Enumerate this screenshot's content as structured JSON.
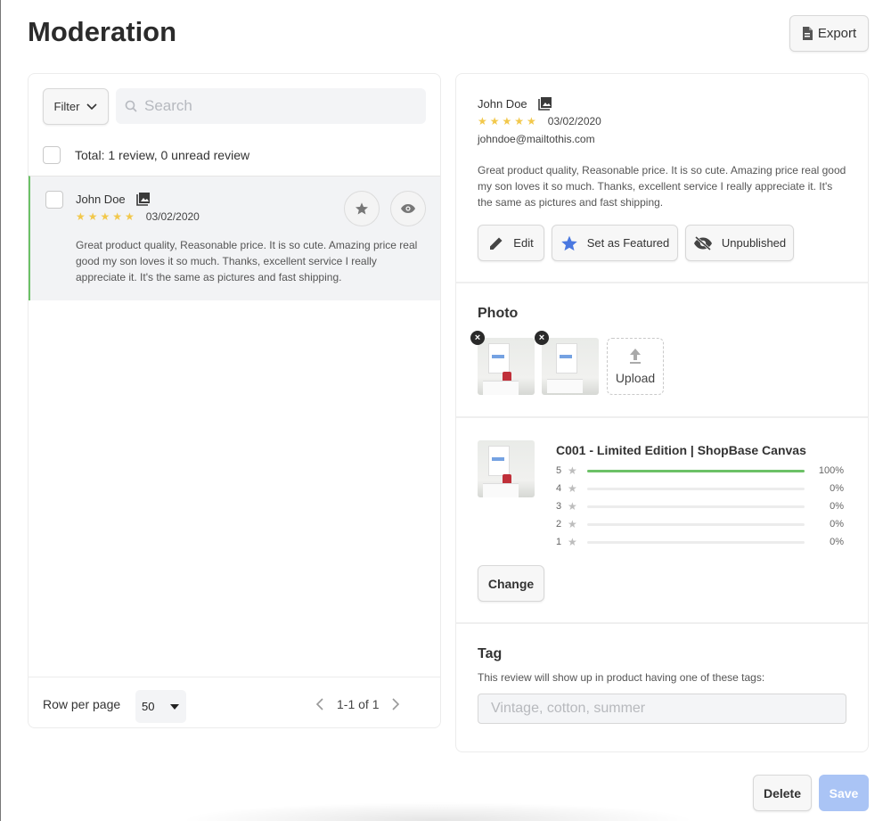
{
  "header": {
    "title": "Moderation",
    "export_label": "Export"
  },
  "list": {
    "filter_label": "Filter",
    "search_placeholder": "Search",
    "total_text": "Total: 1 review, 0 unread review",
    "reviews": [
      {
        "name": "John Doe",
        "rating": 5,
        "stars": "★★★★★",
        "date": "03/02/2020",
        "text": "Great product quality, Reasonable price. It is so cute. Amazing price real good my son loves it so much. Thanks, excellent service I really appreciate it. It's the same as pictures and fast shipping."
      }
    ],
    "footer": {
      "rows_label": "Row per page",
      "rows_value": "50",
      "page_info": "1-1 of 1"
    }
  },
  "detail": {
    "name": "John Doe",
    "rating": 5,
    "stars": "★★★★★",
    "date": "03/02/2020",
    "email": "johndoe@mailtothis.com",
    "text": "Great product quality, Reasonable price. It is so cute. Amazing price real good my son loves it so much. Thanks, excellent service I really appreciate it. It's the same as pictures and fast shipping.",
    "actions": {
      "edit": "Edit",
      "featured": "Set as Featured",
      "unpublish": "Unpublished"
    },
    "photo": {
      "title": "Photo",
      "upload_label": "Upload"
    },
    "product": {
      "name": "C001 - Limited Edition | ShopBase Canvas",
      "ratings": [
        {
          "stars": "5",
          "percent_value": 1.0,
          "label": "100%"
        },
        {
          "stars": "4",
          "percent_value": 0.0,
          "label": "0%"
        },
        {
          "stars": "3",
          "percent_value": 0.0,
          "label": "0%"
        },
        {
          "stars": "2",
          "percent_value": 0.0,
          "label": "0%"
        },
        {
          "stars": "1",
          "percent_value": 0.0,
          "label": "0%"
        }
      ],
      "change_label": "Change"
    },
    "tag": {
      "title": "Tag",
      "description": "This review will show up in product having one of these tags:",
      "placeholder": "Vintage, cotton, summer"
    }
  },
  "footer_actions": {
    "delete_label": "Delete",
    "save_label": "Save"
  },
  "colors": {
    "star": "#f2c84b",
    "accent_green": "#6cc167",
    "featured_blue": "#4a78e0",
    "save_disabled": "#aac4f5"
  }
}
